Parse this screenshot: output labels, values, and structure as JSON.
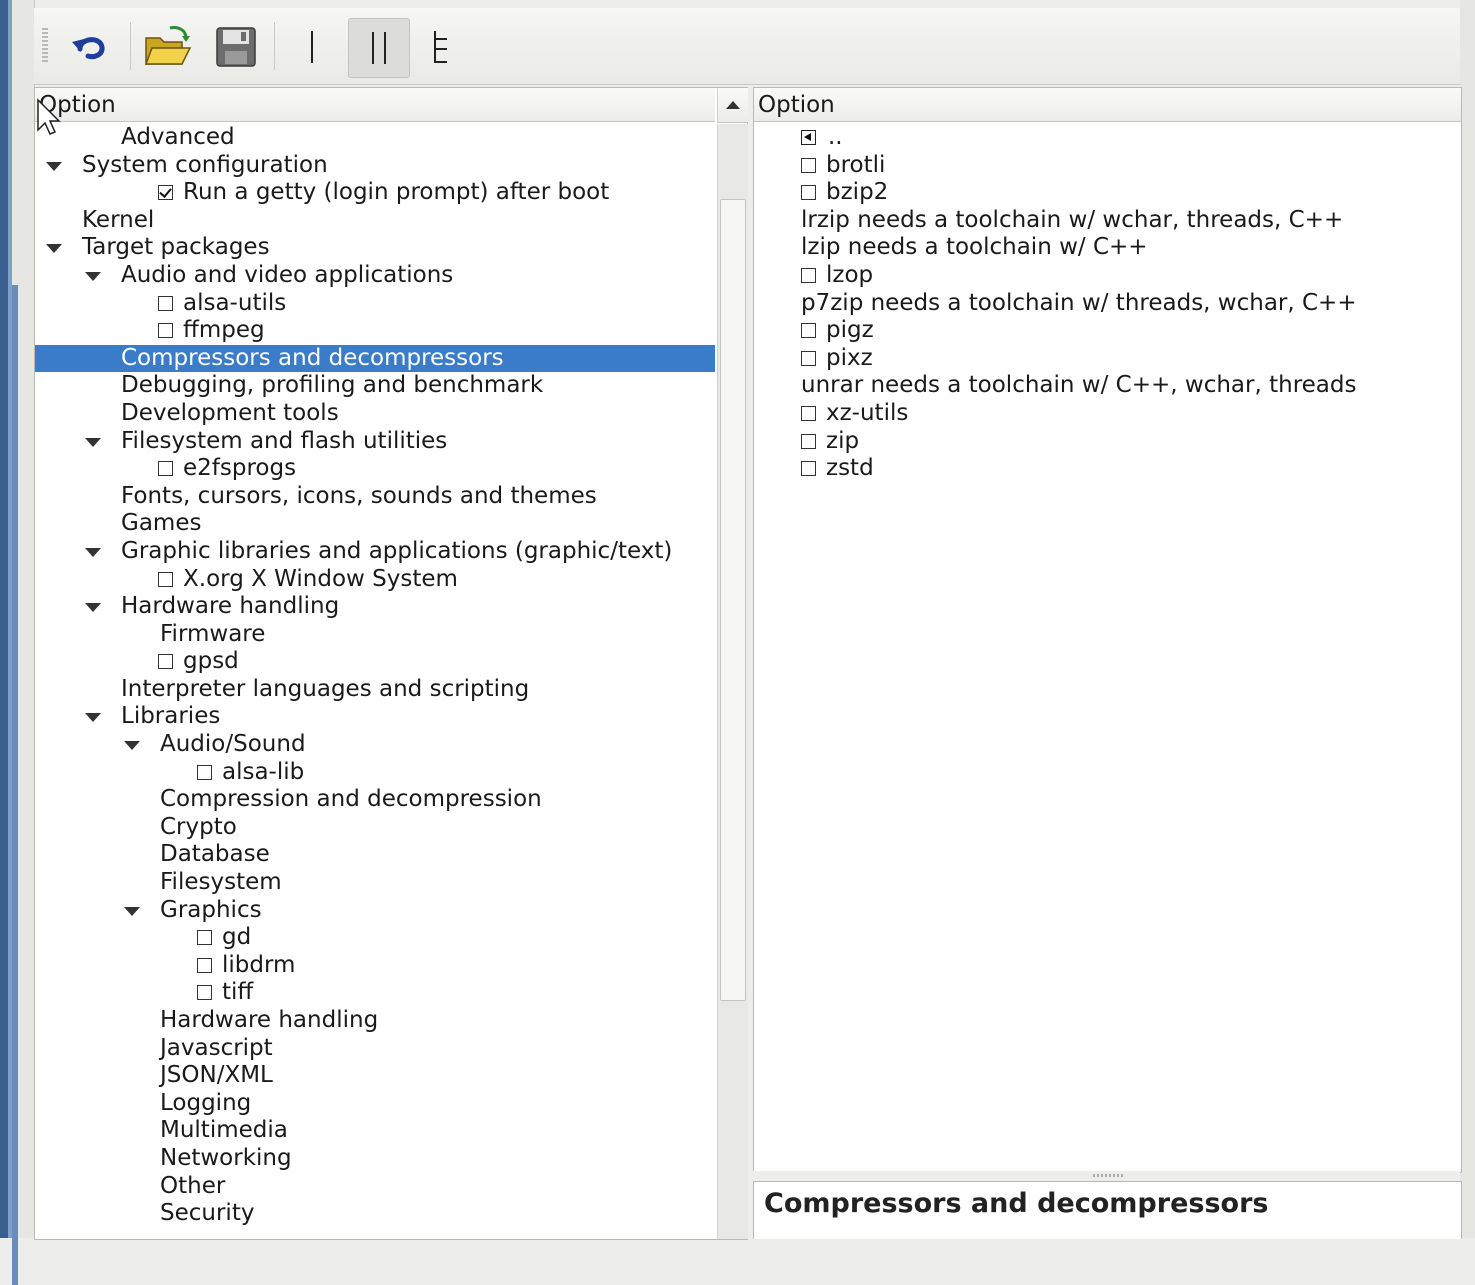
{
  "colors": {
    "selection": "#3a7cc8",
    "frame_blue": "#3a5f8f"
  },
  "toolbar": {
    "buttons": [
      {
        "icon": "undo-icon"
      },
      {
        "icon": "open-folder-icon"
      },
      {
        "icon": "save-icon"
      },
      {
        "icon": "single-view-icon"
      },
      {
        "icon": "split-view-icon",
        "active": true
      },
      {
        "icon": "full-tree-view-icon"
      }
    ]
  },
  "left": {
    "header": "Option",
    "items": [
      {
        "indent": 2,
        "label": "Advanced"
      },
      {
        "indent": 1,
        "label": "System configuration",
        "expanded": true
      },
      {
        "indent": 3,
        "label": "Run a getty (login prompt) after boot",
        "checkbox": "checked"
      },
      {
        "indent": 1,
        "label": "Kernel"
      },
      {
        "indent": 1,
        "label": "Target packages",
        "expanded": true
      },
      {
        "indent": 2,
        "label": "Audio and video applications",
        "expanded": true
      },
      {
        "indent": 3,
        "label": "alsa-utils",
        "checkbox": "unchecked"
      },
      {
        "indent": 3,
        "label": "ffmpeg",
        "checkbox": "unchecked"
      },
      {
        "indent": 2,
        "label": "Compressors and decompressors",
        "selected": true
      },
      {
        "indent": 2,
        "label": "Debugging, profiling and benchmark"
      },
      {
        "indent": 2,
        "label": "Development tools"
      },
      {
        "indent": 2,
        "label": "Filesystem and flash utilities",
        "expanded": true
      },
      {
        "indent": 3,
        "label": "e2fsprogs",
        "checkbox": "unchecked"
      },
      {
        "indent": 2,
        "label": "Fonts, cursors, icons, sounds and themes"
      },
      {
        "indent": 2,
        "label": "Games"
      },
      {
        "indent": 2,
        "label": "Graphic libraries and applications (graphic/text)",
        "expanded": true
      },
      {
        "indent": 3,
        "label": "X.org X Window System",
        "checkbox": "unchecked"
      },
      {
        "indent": 2,
        "label": "Hardware handling",
        "expanded": true
      },
      {
        "indent": 3,
        "label": "Firmware"
      },
      {
        "indent": 3,
        "label": "gpsd",
        "checkbox": "unchecked"
      },
      {
        "indent": 2,
        "label": "Interpreter languages and scripting"
      },
      {
        "indent": 2,
        "label": "Libraries",
        "expanded": true
      },
      {
        "indent": 3,
        "label": "Audio/Sound",
        "expanded": true
      },
      {
        "indent": 4,
        "label": "alsa-lib",
        "checkbox": "unchecked"
      },
      {
        "indent": 3,
        "label": "Compression and decompression"
      },
      {
        "indent": 3,
        "label": "Crypto"
      },
      {
        "indent": 3,
        "label": "Database"
      },
      {
        "indent": 3,
        "label": "Filesystem"
      },
      {
        "indent": 3,
        "label": "Graphics",
        "expanded": true
      },
      {
        "indent": 4,
        "label": "gd",
        "checkbox": "unchecked"
      },
      {
        "indent": 4,
        "label": "libdrm",
        "checkbox": "unchecked"
      },
      {
        "indent": 4,
        "label": "tiff",
        "checkbox": "unchecked"
      },
      {
        "indent": 3,
        "label": "Hardware handling"
      },
      {
        "indent": 3,
        "label": "Javascript"
      },
      {
        "indent": 3,
        "label": "JSON/XML"
      },
      {
        "indent": 3,
        "label": "Logging"
      },
      {
        "indent": 3,
        "label": "Multimedia"
      },
      {
        "indent": 3,
        "label": "Networking"
      },
      {
        "indent": 3,
        "label": "Other"
      },
      {
        "indent": 3,
        "label": "Security"
      }
    ]
  },
  "right": {
    "header": "Option",
    "items": [
      {
        "label": "..",
        "kind": "parent"
      },
      {
        "label": "brotli",
        "kind": "checkbox"
      },
      {
        "label": "bzip2",
        "kind": "checkbox"
      },
      {
        "label": "lrzip needs a toolchain w/ wchar, threads, C++",
        "kind": "comment"
      },
      {
        "label": "lzip needs a toolchain w/ C++",
        "kind": "comment"
      },
      {
        "label": "lzop",
        "kind": "checkbox"
      },
      {
        "label": "p7zip needs a toolchain w/ threads, wchar, C++",
        "kind": "comment"
      },
      {
        "label": "pigz",
        "kind": "checkbox"
      },
      {
        "label": "pixz",
        "kind": "checkbox"
      },
      {
        "label": "unrar needs a toolchain w/ C++, wchar, threads",
        "kind": "comment"
      },
      {
        "label": "xz-utils",
        "kind": "checkbox"
      },
      {
        "label": "zip",
        "kind": "checkbox"
      },
      {
        "label": "zstd",
        "kind": "checkbox"
      }
    ]
  },
  "help": {
    "title": "Compressors and decompressors"
  }
}
